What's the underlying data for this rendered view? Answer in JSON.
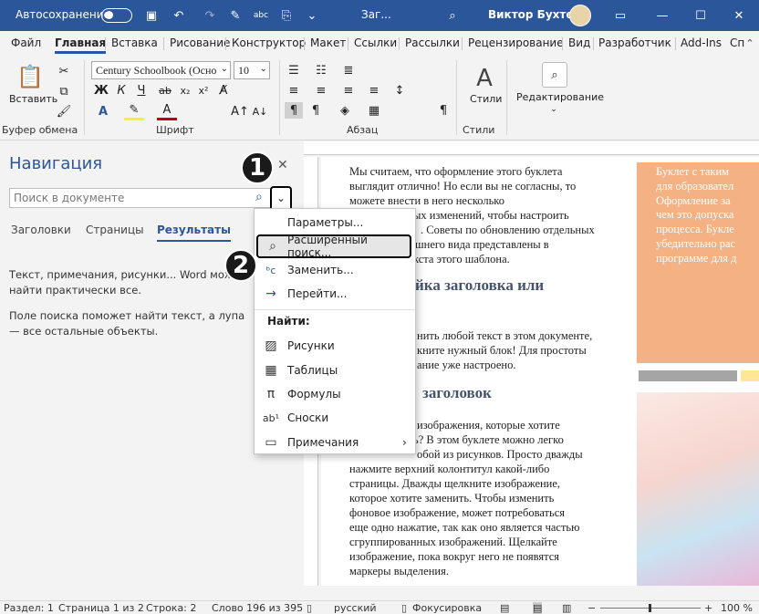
{
  "titlebar": {
    "autosave_label": "Автосохранение",
    "doc_title": "Заг...",
    "user_name": "Виктор Бухтеев",
    "colors": {
      "bg": "#2b579a"
    }
  },
  "tabs": [
    "Файл",
    "Главная",
    "Вставка",
    "Рисование",
    "Конструктор",
    "Макет",
    "Ссылки",
    "Рассылки",
    "Рецензирование",
    "Вид",
    "Разработчик",
    "Add-Ins",
    "Сп"
  ],
  "ribbon": {
    "paste_label": "Вставить",
    "font_name": "Century Schoolbook (Осно",
    "font_size": "10",
    "styles_label": "Стили",
    "editing_label": "Редактирование",
    "groups": {
      "clipboard": "Буфер обмена",
      "font": "Шрифт",
      "paragraph": "Абзац",
      "styles": "Стили"
    }
  },
  "nav": {
    "title": "Навигация",
    "search_placeholder": "Поиск в документе",
    "tabs": [
      "Заголовки",
      "Страницы",
      "Результаты"
    ],
    "text1": "Текст, примечания, рисунки... Word может найти практически все.",
    "text2": "Поле поиска поможет найти текст, а лупа — все остальные объекты."
  },
  "menu": {
    "options": "Параметры...",
    "advanced": "Расширенный поиск...",
    "replace": "Заменить...",
    "goto": "Перейти...",
    "find_header": "Найти:",
    "graphics": "Рисунки",
    "tables": "Таблицы",
    "equations": "Формулы",
    "footnotes": "Сноски",
    "comments": "Примечания"
  },
  "badges": [
    "1",
    "2"
  ],
  "doc": {
    "lines_top": [
      "Мы считаем, что оформление этого буклета",
      "выглядит отлично! Но если вы не согласны, то",
      "можете внести в него несколько",
      "ых изменений, чтобы настроить",
      ". Советы по обновлению отдельных",
      "шнего вида представлены в",
      "кста этого шаблона."
    ],
    "heading1": "йка заголовка или",
    "lines_mid": [
      "нить любой текст в этом документе,",
      "кните нужный блок! Для простоты",
      "ание уже настроено."
    ],
    "heading2": "заголовок",
    "lines_bottom": [
      "изображения, которые хотите",
      "ь? В этом буклете можно легко",
      "обой из рисунков. Просто дважды",
      "нажмите верхний колонтитул какой-либо",
      "страницы. Дважды щелкните изображение,",
      "которое хотите заменить. Чтобы изменить",
      "фоновое изображение, может потребоваться",
      "еще одно нажатие, так как оно является частью",
      "сгруппированных изображений. Щелкайте",
      "изображение, пока вокруг него не появятся",
      "маркеры выделения."
    ],
    "side_lines": [
      "Буклет с таким",
      "для образовател",
      "Оформление за",
      "чем это допуска",
      "процесса. Букле",
      "убедительно рас",
      "программе для д"
    ]
  },
  "status": {
    "section": "Раздел: 1",
    "page": "Страница 1 из 2",
    "line": "Строка: 2",
    "words": "Слово 196 из 395",
    "lang": "русский",
    "focus": "Фокусировка",
    "zoom": "100 %"
  }
}
